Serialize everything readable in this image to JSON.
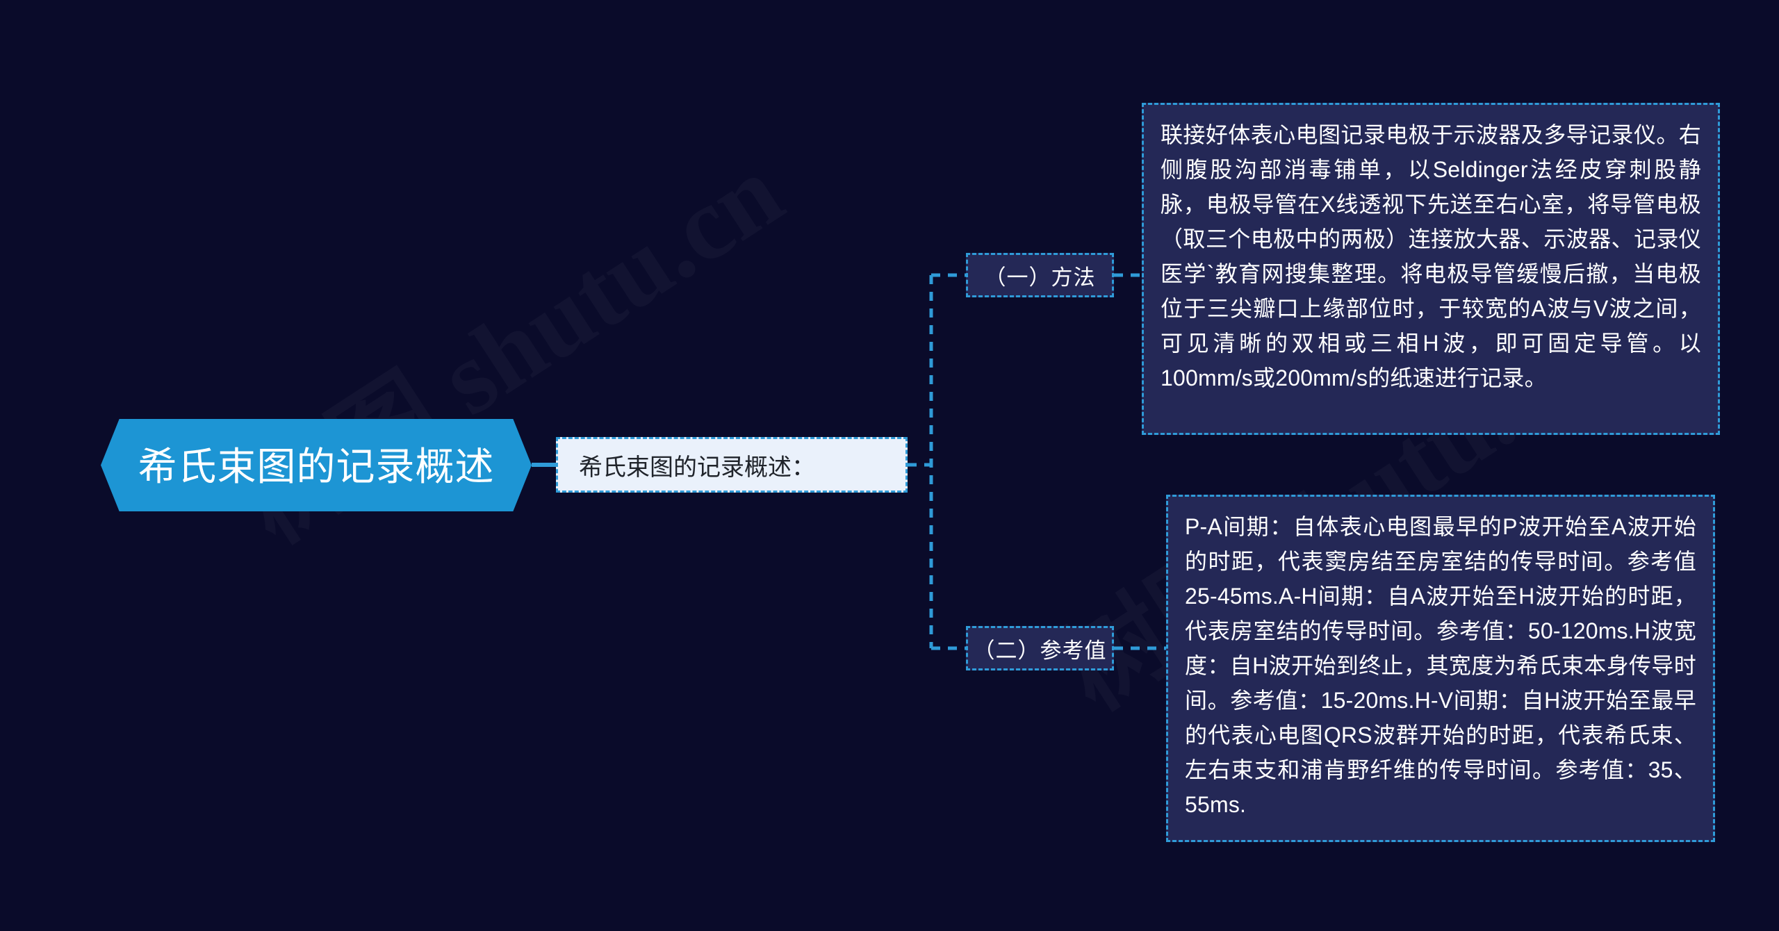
{
  "theme": {
    "background": "#0a0b2a",
    "root_fill": "#1d95d4",
    "node_fill": "#242856",
    "accent_dashed": "#2f9bd8",
    "white_node_fill": "#eaf1fb",
    "text_light": "#ffffff",
    "text_dark": "#20242b"
  },
  "watermark": {
    "line_a": "树图 shutu.cn",
    "line_b": "树图 shutu.cn",
    "line_c": "shutu.cn"
  },
  "mindmap": {
    "root": {
      "label": "希氏束图的记录概述"
    },
    "level2": {
      "label": "希氏束图的记录概述："
    },
    "branches": [
      {
        "label": "（一）方法",
        "content": "联接好体表心电图记录电极于示波器及多导记录仪。右侧腹股沟部消毒铺单，以Seldinger法经皮穿刺股静脉，电极导管在X线透视下先送至右心室，将导管电极（取三个电极中的两极）连接放大器、示波器、记录仪医学`教育网搜集整理。将电极导管缓慢后撤，当电极位于三尖瓣口上缘部位时，于较宽的A波与V波之间，可见清晰的双相或三相H波，即可固定导管。以100mm/s或200mm/s的纸速进行记录。"
      },
      {
        "label": "（二）参考值",
        "content": "P-A间期：自体表心电图最早的P波开始至A波开始的时距，代表窦房结至房室结的传导时间。参考值25-45ms.A-H间期：自A波开始至H波开始的时距，代表房室结的传导时间。参考值：50-120ms.H波宽度：自H波开始到终止，其宽度为希氏束本身传导时间。参考值：15-20ms.H-V间期：自H波开始至最早的代表心电图QRS波群开始的时距，代表希氏束、左右束支和浦肯野纤维的传导时间。参考值：35、55ms."
      }
    ]
  }
}
